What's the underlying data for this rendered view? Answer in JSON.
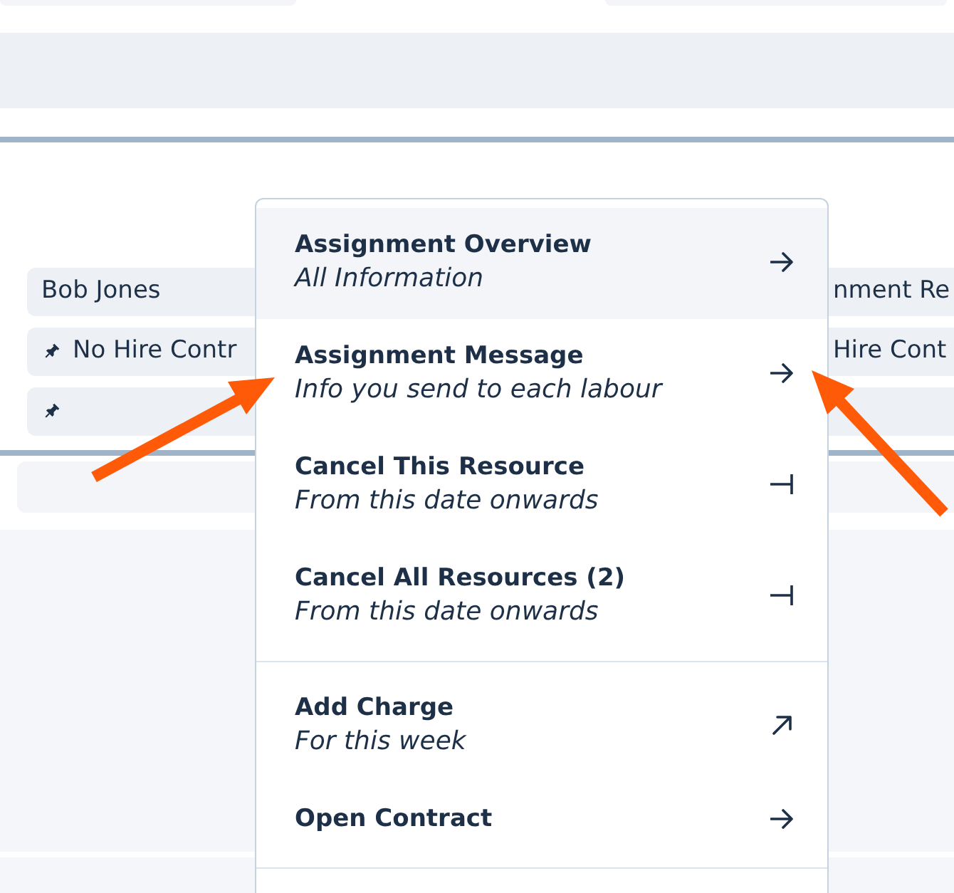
{
  "left_cells": [
    {
      "kind": "text",
      "text": "Bob Jones"
    },
    {
      "kind": "pinned",
      "text": "No Hire Contr"
    },
    {
      "kind": "pinned"
    }
  ],
  "right_cells": [
    {
      "kind": "text",
      "text": "nment Re"
    },
    {
      "kind": "text",
      "text": "Hire Cont"
    },
    {
      "kind": "blank"
    }
  ],
  "context_menu": {
    "sections": [
      {
        "items": [
          {
            "title": "Assignment Overview",
            "subtitle": "All Information",
            "kind": "open",
            "selected": true
          },
          {
            "title": "Assignment Message",
            "subtitle": "Info you send to each labour",
            "kind": "open",
            "selected": false
          },
          {
            "title": "Cancel This Resource",
            "subtitle": "From this date onwards",
            "kind": "cancel",
            "selected": false
          },
          {
            "title": "Cancel All Resources (2)",
            "subtitle": "From this date onwards",
            "kind": "cancel",
            "selected": false
          }
        ]
      },
      {
        "items": [
          {
            "title": "Add Charge",
            "subtitle": "For this week",
            "kind": "add",
            "selected": false
          },
          {
            "title": "Open Contract",
            "kind": "open",
            "selected": false
          }
        ]
      }
    ]
  }
}
